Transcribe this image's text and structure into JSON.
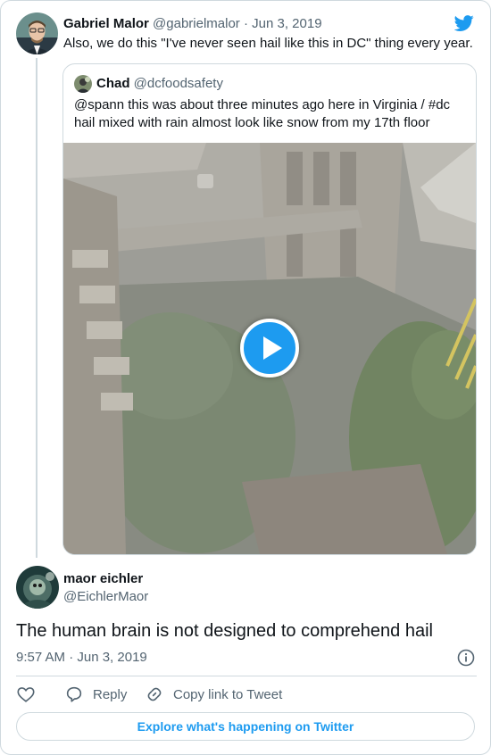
{
  "parent_tweet": {
    "author_name": "Gabriel Malor",
    "author_handle": "@gabrielmalor",
    "date_text": "Jun 3, 2019",
    "text": "Also, we do this \"I've never seen hail like this in DC\" thing every year.",
    "quoted_tweet": {
      "author_name": "Chad",
      "author_handle": "@dcfoodsafety",
      "text": "@spann this was about three minutes ago here in Virginia / #dc hail mixed with rain almost look like snow from my 17th floor"
    }
  },
  "main_tweet": {
    "author_name": "maor eichler",
    "author_handle": "@EichlerMaor",
    "text": "The human brain is not designed to comprehend hail",
    "timestamp": "9:57 AM · Jun 3, 2019"
  },
  "actions": {
    "reply_label": "Reply",
    "copy_link_label": "Copy link to Tweet"
  },
  "explore_label": "Explore what's happening on Twitter",
  "icons": {
    "brand": "twitter-bird-icon",
    "like": "heart-icon",
    "reply": "speech-bubble-icon",
    "copy_link": "link-icon",
    "info": "info-icon",
    "play": "play-icon"
  },
  "colors": {
    "accent": "#1d9bf0",
    "text": "#0f1419",
    "muted": "#536471",
    "border": "#cfd9de"
  }
}
